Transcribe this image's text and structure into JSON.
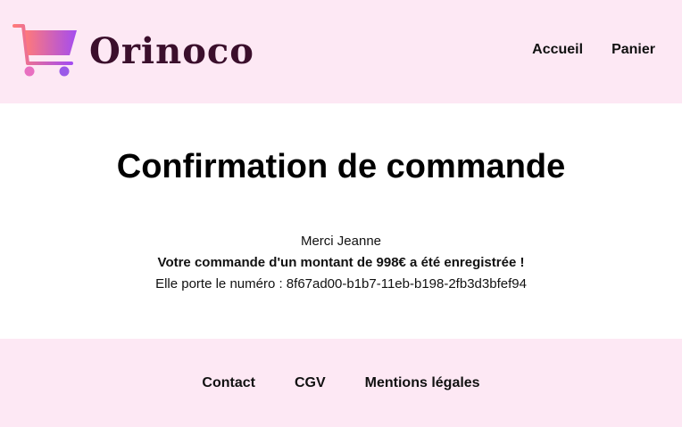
{
  "header": {
    "logo_text": "Orinoco",
    "nav": [
      {
        "label": "Accueil"
      },
      {
        "label": "Panier"
      }
    ]
  },
  "main": {
    "title": "Confirmation de commande",
    "thanks": "Merci Jeanne",
    "amount_message": "Votre commande d'un montant de 998€ a été enregistrée !",
    "order_number_message": "Elle porte le numéro : 8f67ad00-b1b7-11eb-b198-2fb3d3bfef94"
  },
  "footer": {
    "links": [
      {
        "label": "Contact"
      },
      {
        "label": "CGV"
      },
      {
        "label": "Mentions légales"
      }
    ]
  },
  "colors": {
    "header_bg": "#fde8f4",
    "footer_bg": "#fde8f4",
    "logo_text": "#3b0f2c",
    "cart_gradient_start": "#ff7a7a",
    "cart_gradient_end": "#a44cf0"
  }
}
